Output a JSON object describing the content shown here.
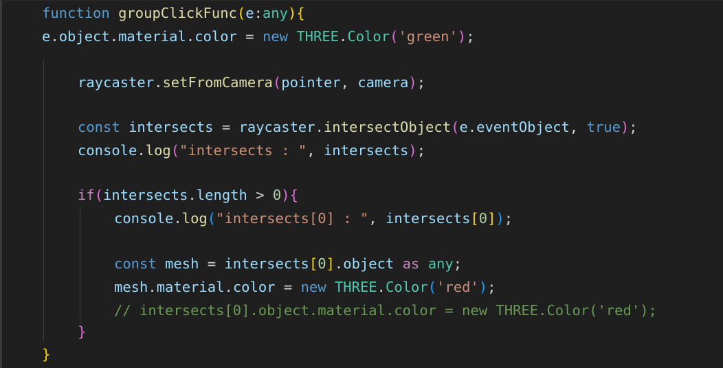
{
  "code_lines": [
    [
      {
        "t": "function ",
        "c": "kw"
      },
      {
        "t": "groupClickFunc",
        "c": "fn"
      },
      {
        "t": "(",
        "c": "b1"
      },
      {
        "t": "e",
        "c": "var"
      },
      {
        "t": ":",
        "c": "pun"
      },
      {
        "t": "any",
        "c": "type"
      },
      {
        "t": ")",
        "c": "b1"
      },
      {
        "t": "{",
        "c": "b1"
      }
    ],
    [
      {
        "t": "e",
        "c": "var"
      },
      {
        "t": ".",
        "c": "pun"
      },
      {
        "t": "object",
        "c": "var"
      },
      {
        "t": ".",
        "c": "pun"
      },
      {
        "t": "material",
        "c": "var"
      },
      {
        "t": ".",
        "c": "pun"
      },
      {
        "t": "color",
        "c": "var"
      },
      {
        "t": " = ",
        "c": "pun"
      },
      {
        "t": "new ",
        "c": "kw"
      },
      {
        "t": "THREE",
        "c": "type"
      },
      {
        "t": ".",
        "c": "pun"
      },
      {
        "t": "Color",
        "c": "type"
      },
      {
        "t": "(",
        "c": "b2"
      },
      {
        "t": "'green'",
        "c": "str"
      },
      {
        "t": ")",
        "c": "b2"
      },
      {
        "t": ";",
        "c": "pun"
      }
    ],
    [],
    [
      {
        "t": "raycaster",
        "c": "var"
      },
      {
        "t": ".",
        "c": "pun"
      },
      {
        "t": "setFromCamera",
        "c": "fn"
      },
      {
        "t": "(",
        "c": "b2"
      },
      {
        "t": "pointer",
        "c": "var"
      },
      {
        "t": ", ",
        "c": "pun"
      },
      {
        "t": "camera",
        "c": "var"
      },
      {
        "t": ")",
        "c": "b2"
      },
      {
        "t": ";",
        "c": "pun"
      }
    ],
    [],
    [
      {
        "t": "const ",
        "c": "kw"
      },
      {
        "t": "intersects",
        "c": "var"
      },
      {
        "t": " = ",
        "c": "pun"
      },
      {
        "t": "raycaster",
        "c": "var"
      },
      {
        "t": ".",
        "c": "pun"
      },
      {
        "t": "intersectObject",
        "c": "fn"
      },
      {
        "t": "(",
        "c": "b2"
      },
      {
        "t": "e",
        "c": "var"
      },
      {
        "t": ".",
        "c": "pun"
      },
      {
        "t": "eventObject",
        "c": "var"
      },
      {
        "t": ", ",
        "c": "pun"
      },
      {
        "t": "true",
        "c": "kw"
      },
      {
        "t": ")",
        "c": "b2"
      },
      {
        "t": ";",
        "c": "pun"
      }
    ],
    [
      {
        "t": "console",
        "c": "var"
      },
      {
        "t": ".",
        "c": "pun"
      },
      {
        "t": "log",
        "c": "fn"
      },
      {
        "t": "(",
        "c": "b2"
      },
      {
        "t": "\"intersects : \"",
        "c": "str"
      },
      {
        "t": ", ",
        "c": "pun"
      },
      {
        "t": "intersects",
        "c": "var"
      },
      {
        "t": ")",
        "c": "b2"
      },
      {
        "t": ";",
        "c": "pun"
      }
    ],
    [],
    [
      {
        "t": "if",
        "c": "ctl"
      },
      {
        "t": "(",
        "c": "b2"
      },
      {
        "t": "intersects",
        "c": "var"
      },
      {
        "t": ".",
        "c": "pun"
      },
      {
        "t": "length",
        "c": "var"
      },
      {
        "t": " > ",
        "c": "pun"
      },
      {
        "t": "0",
        "c": "num"
      },
      {
        "t": ")",
        "c": "b2"
      },
      {
        "t": "{",
        "c": "b2"
      }
    ],
    [
      {
        "t": "console",
        "c": "var"
      },
      {
        "t": ".",
        "c": "pun"
      },
      {
        "t": "log",
        "c": "fn"
      },
      {
        "t": "(",
        "c": "b3"
      },
      {
        "t": "\"intersects[0] : \"",
        "c": "str"
      },
      {
        "t": ", ",
        "c": "pun"
      },
      {
        "t": "intersects",
        "c": "var"
      },
      {
        "t": "[",
        "c": "b1"
      },
      {
        "t": "0",
        "c": "num"
      },
      {
        "t": "]",
        "c": "b1"
      },
      {
        "t": ")",
        "c": "b3"
      },
      {
        "t": ";",
        "c": "pun"
      }
    ],
    [],
    [
      {
        "t": "const ",
        "c": "kw"
      },
      {
        "t": "mesh",
        "c": "var"
      },
      {
        "t": " = ",
        "c": "pun"
      },
      {
        "t": "intersects",
        "c": "var"
      },
      {
        "t": "[",
        "c": "b1"
      },
      {
        "t": "0",
        "c": "num"
      },
      {
        "t": "]",
        "c": "b1"
      },
      {
        "t": ".",
        "c": "pun"
      },
      {
        "t": "object",
        "c": "var"
      },
      {
        "t": " as ",
        "c": "ctl"
      },
      {
        "t": "any",
        "c": "type"
      },
      {
        "t": ";",
        "c": "pun"
      }
    ],
    [
      {
        "t": "mesh",
        "c": "var"
      },
      {
        "t": ".",
        "c": "pun"
      },
      {
        "t": "material",
        "c": "var"
      },
      {
        "t": ".",
        "c": "pun"
      },
      {
        "t": "color",
        "c": "var"
      },
      {
        "t": " = ",
        "c": "pun"
      },
      {
        "t": "new ",
        "c": "kw"
      },
      {
        "t": "THREE",
        "c": "type"
      },
      {
        "t": ".",
        "c": "pun"
      },
      {
        "t": "Color",
        "c": "type"
      },
      {
        "t": "(",
        "c": "b3"
      },
      {
        "t": "'red'",
        "c": "str"
      },
      {
        "t": ")",
        "c": "b3"
      },
      {
        "t": ";",
        "c": "pun"
      }
    ],
    [
      {
        "t": "// intersects[0].object.material.color = new THREE.Color('red');",
        "c": "cmt"
      }
    ],
    [
      {
        "t": "}",
        "c": "b2"
      }
    ],
    [
      {
        "t": "}",
        "c": "b1"
      }
    ]
  ],
  "colors": {
    "background": "#1f1f1f",
    "keyword": "#569cd6",
    "control": "#c586c0",
    "function": "#dcdcaa",
    "variable": "#9cdcfe",
    "type": "#4ec9b0",
    "string": "#ce9178",
    "number": "#b5cea8",
    "comment": "#6a9955"
  }
}
